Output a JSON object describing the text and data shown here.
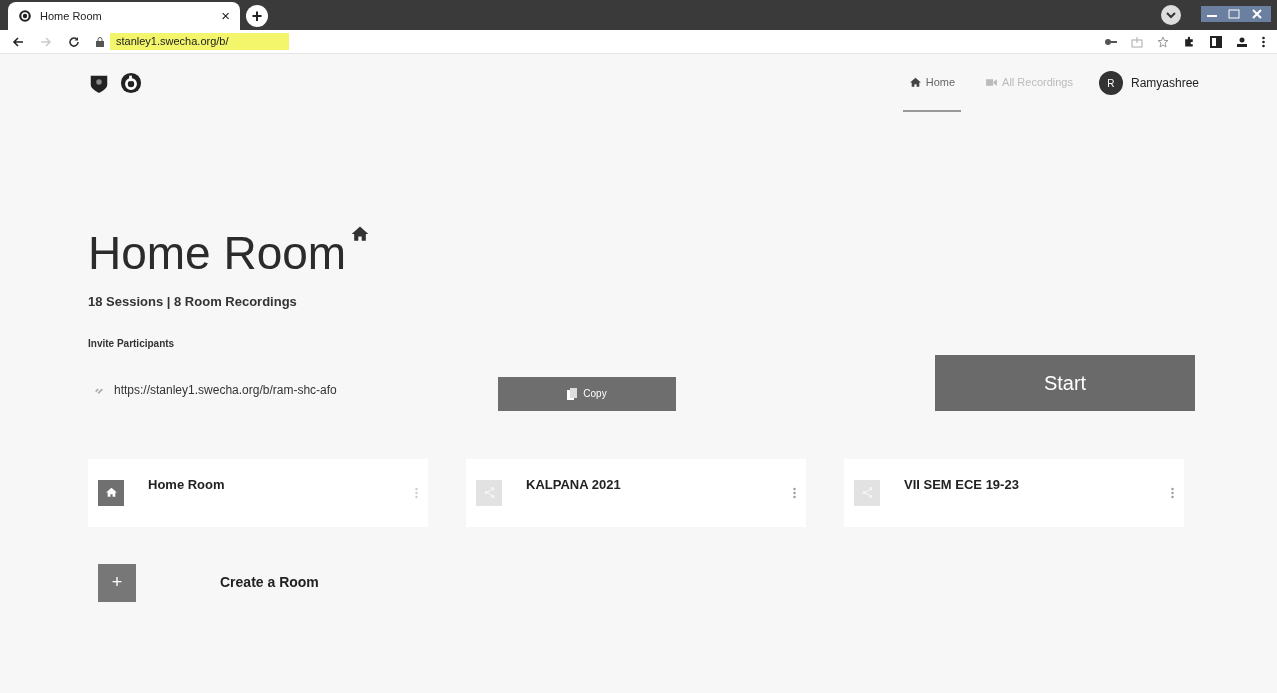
{
  "browser": {
    "tab_title": "Home Room",
    "close": "×",
    "new_tab": "+",
    "address": "stanley1.swecha.org/b/"
  },
  "nav": {
    "items": [
      {
        "label": "Home",
        "selected": true
      },
      {
        "label": "All Recordings",
        "selected": false
      }
    ],
    "user": {
      "initial": "R",
      "name": "Ramyashree"
    }
  },
  "room": {
    "title": "Home Room",
    "stats": "18 Sessions | 8 Room Recordings",
    "invite_label": "Invite Participants",
    "invite_link": "https://stanley1.swecha.org/b/ram-shc-afo",
    "copy_button": "Copy",
    "start_button": "Start"
  },
  "rooms": [
    {
      "name": "Home Room",
      "kind": "home",
      "selected": true
    },
    {
      "name": "KALPANA 2021",
      "kind": "shared",
      "selected": false
    },
    {
      "name": "VII SEM ECE 19-23",
      "kind": "shared",
      "selected": false
    }
  ],
  "create_room": {
    "icon": "+",
    "label": "Create a Room"
  }
}
